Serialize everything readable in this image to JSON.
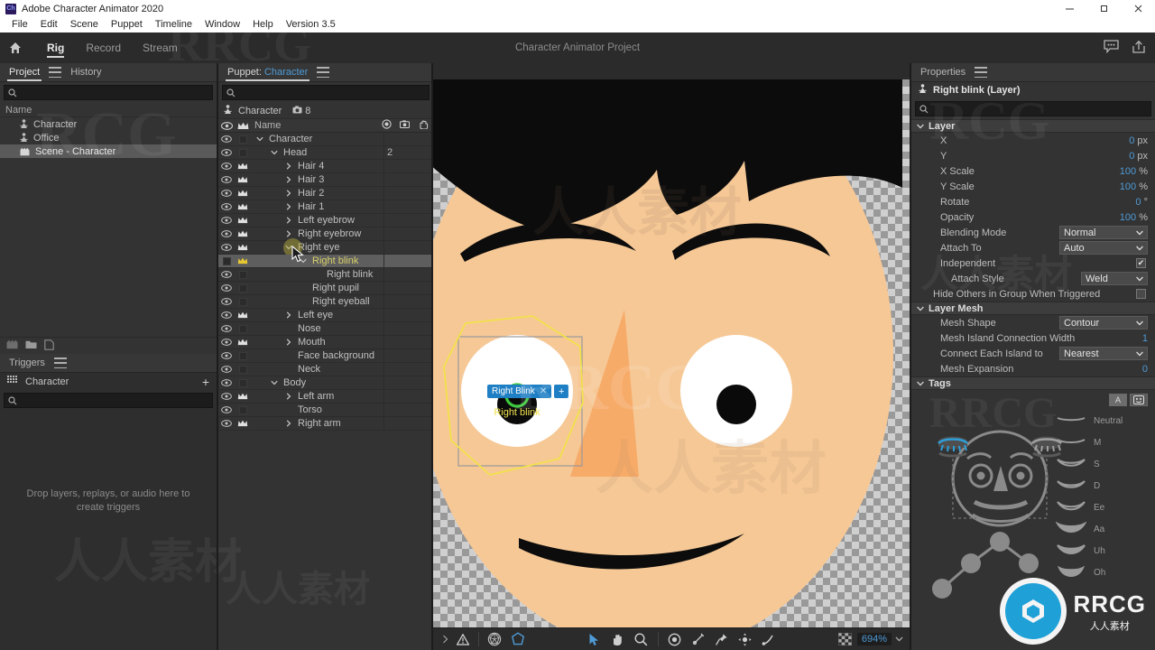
{
  "window": {
    "app_icon": "Ch",
    "title": "Adobe Character Animator 2020",
    "minimize": "minimize-icon",
    "maximize": "maximize-icon",
    "close": "close-icon"
  },
  "menubar": {
    "items": [
      "File",
      "Edit",
      "Scene",
      "Puppet",
      "Timeline",
      "Window",
      "Help",
      "Version 3.5"
    ]
  },
  "appheader": {
    "home_icon": "home-icon",
    "tabs": [
      {
        "label": "Rig",
        "active": true
      },
      {
        "label": "Record",
        "active": false
      },
      {
        "label": "Stream",
        "active": false
      }
    ],
    "project_title": "Character Animator Project",
    "comment_icon": "comment-icon",
    "share_icon": "share-icon"
  },
  "project_panel": {
    "tabs": [
      {
        "label": "Project",
        "active": true
      },
      {
        "label": "History",
        "active": false
      }
    ],
    "search_placeholder": "",
    "column_header": "Name",
    "items": [
      {
        "label": "Character",
        "icon": "puppet-icon",
        "selected": false
      },
      {
        "label": "Office",
        "icon": "puppet-icon",
        "selected": false
      },
      {
        "label": "Scene - Character",
        "icon": "scene-icon",
        "selected": true
      }
    ],
    "footer_icons": [
      "new-scene-icon",
      "new-folder-icon",
      "new-puppet-icon"
    ]
  },
  "triggers_panel": {
    "title": "Triggers",
    "menu_icon": "panel-menu-icon",
    "group_icon": "grid-icon",
    "group_label": "Character",
    "add_icon": "plus-icon",
    "search_placeholder": "",
    "empty_message_line1": "Drop layers, replays, or audio here to",
    "empty_message_line2": "create triggers"
  },
  "puppet_panel": {
    "title_prefix": "Puppet:",
    "title_name": "Character",
    "menu_icon": "panel-menu-icon",
    "search_placeholder": "",
    "puppet_name": "Character",
    "puppet_count": "8",
    "columns": {
      "name": "Name",
      "eye": "visibility-icon",
      "crown": "crown-icon",
      "origin": "origin-icon",
      "camera": "camera-icon",
      "hand": "draggable-icon"
    },
    "layers": [
      {
        "label": "Character",
        "depth": 0,
        "eye": true,
        "crown": "square",
        "twisty": "down",
        "num": "",
        "selected": false
      },
      {
        "label": "Head",
        "depth": 1,
        "eye": true,
        "crown": "square",
        "twisty": "down",
        "num": "2",
        "selected": false
      },
      {
        "label": "Hair 4",
        "depth": 2,
        "eye": true,
        "crown": "crown",
        "twisty": "right",
        "num": "",
        "selected": false
      },
      {
        "label": "Hair 3",
        "depth": 2,
        "eye": true,
        "crown": "crown",
        "twisty": "right",
        "num": "",
        "selected": false
      },
      {
        "label": "Hair 2",
        "depth": 2,
        "eye": true,
        "crown": "crown",
        "twisty": "right",
        "num": "",
        "selected": false
      },
      {
        "label": "Hair 1",
        "depth": 2,
        "eye": true,
        "crown": "crown",
        "twisty": "right",
        "num": "",
        "selected": false
      },
      {
        "label": "Left eyebrow",
        "depth": 2,
        "eye": true,
        "crown": "crown",
        "twisty": "right",
        "num": "",
        "selected": false
      },
      {
        "label": "Right eyebrow",
        "depth": 2,
        "eye": true,
        "crown": "crown",
        "twisty": "right",
        "num": "",
        "selected": false
      },
      {
        "label": "Right eye",
        "depth": 2,
        "eye": true,
        "crown": "crown",
        "twisty": "down",
        "num": "",
        "selected": false
      },
      {
        "label": "Right blink",
        "depth": 3,
        "eye": false,
        "crown": "crown-y",
        "twisty": "down",
        "num": "",
        "selected": true
      },
      {
        "label": "Right blink",
        "depth": 4,
        "eye": true,
        "crown": "square",
        "twisty": "none",
        "num": "",
        "selected": false
      },
      {
        "label": "Right pupil",
        "depth": 3,
        "eye": true,
        "crown": "square",
        "twisty": "none",
        "num": "",
        "selected": false
      },
      {
        "label": "Right eyeball",
        "depth": 3,
        "eye": true,
        "crown": "square",
        "twisty": "none",
        "num": "",
        "selected": false
      },
      {
        "label": "Left eye",
        "depth": 2,
        "eye": true,
        "crown": "crown",
        "twisty": "right",
        "num": "",
        "selected": false
      },
      {
        "label": "Nose",
        "depth": 2,
        "eye": true,
        "crown": "square",
        "twisty": "none",
        "num": "",
        "selected": false
      },
      {
        "label": "Mouth",
        "depth": 2,
        "eye": true,
        "crown": "crown",
        "twisty": "right",
        "num": "",
        "selected": false
      },
      {
        "label": "Face background",
        "depth": 2,
        "eye": true,
        "crown": "square",
        "twisty": "none",
        "num": "",
        "selected": false
      },
      {
        "label": "Neck",
        "depth": 2,
        "eye": true,
        "crown": "square",
        "twisty": "none",
        "num": "",
        "selected": false
      },
      {
        "label": "Body",
        "depth": 1,
        "eye": true,
        "crown": "square",
        "twisty": "down",
        "num": "",
        "selected": false
      },
      {
        "label": "Left arm",
        "depth": 2,
        "eye": true,
        "crown": "crown",
        "twisty": "right",
        "num": "",
        "selected": false
      },
      {
        "label": "Torso",
        "depth": 2,
        "eye": true,
        "crown": "square",
        "twisty": "none",
        "num": "",
        "selected": false
      },
      {
        "label": "Right arm",
        "depth": 2,
        "eye": true,
        "crown": "crown",
        "twisty": "right",
        "num": "",
        "selected": false
      }
    ]
  },
  "canvas": {
    "mesh_label": "Right blink",
    "tag_chip_label": "Right Blink",
    "tag_chip_remove": "close-icon",
    "tag_chip_add": "plus-icon",
    "toolbar": {
      "overflow_icon": "chevron-right-icon",
      "warning_icon": "warning-icon",
      "mesh_icon": "mesh-icon",
      "handles_icon": "handles-icon",
      "select_icon": "select-tool-icon",
      "hand_icon": "hand-tool-icon",
      "zoom_icon": "zoom-tool-icon",
      "origin_icon": "origin-tool-icon",
      "stick_icon": "stick-tool-icon",
      "pin_icon": "pin-tool-icon",
      "dragger_icon": "dragger-tool-icon",
      "stick_curve_icon": "stick-curve-tool-icon",
      "transparency_icon": "transparency-grid-icon",
      "zoom_level": "694%",
      "zoom_dropdown": "chevron-down-icon"
    },
    "colors": {
      "skin": "#f6c896",
      "hair": "#0c0c0c",
      "eye_white": "#ffffff",
      "pupil": "#0a0a0a",
      "mesh_outline": "#f2e14c",
      "tag_chip_bg": "#1f7fc4",
      "green_origin": "#3cc83c"
    }
  },
  "properties_panel": {
    "title": "Properties",
    "menu_icon": "panel-menu-icon",
    "selection_icon": "layer-icon",
    "selection_name": "Right blink (Layer)",
    "search_placeholder": "",
    "sections": [
      {
        "name": "Layer",
        "rows": [
          {
            "label": "X",
            "type": "number",
            "value": "0",
            "unit": "px"
          },
          {
            "label": "Y",
            "type": "number",
            "value": "0",
            "unit": "px"
          },
          {
            "label": "X Scale",
            "type": "number",
            "value": "100",
            "unit": "%"
          },
          {
            "label": "Y Scale",
            "type": "number",
            "value": "100",
            "unit": "%"
          },
          {
            "label": "Rotate",
            "type": "number",
            "value": "0",
            "unit": "°"
          },
          {
            "label": "Opacity",
            "type": "number",
            "value": "100",
            "unit": "%"
          },
          {
            "label": "Blending Mode",
            "type": "select",
            "value": "Normal"
          },
          {
            "label": "Attach To",
            "type": "select",
            "value": "Auto"
          },
          {
            "label": "Independent",
            "type": "checkbox",
            "value": "checked"
          },
          {
            "label": "Attach Style",
            "type": "select",
            "value": "Weld",
            "indent": 2
          },
          {
            "label": "Hide Others in Group When Triggered",
            "type": "checkbox",
            "value": "unchecked",
            "full": true
          }
        ]
      },
      {
        "name": "Layer Mesh",
        "rows": [
          {
            "label": "Mesh Shape",
            "type": "select",
            "value": "Contour"
          },
          {
            "label": "Mesh Island Connection Width",
            "type": "number",
            "value": "1",
            "unit": ""
          },
          {
            "label": "Connect Each Island to",
            "type": "select",
            "value": "Nearest"
          },
          {
            "label": "Mesh Expansion",
            "type": "number",
            "value": "0",
            "unit": ""
          }
        ]
      }
    ],
    "tags": {
      "name": "Tags",
      "toggle_text": "A",
      "toggle_face": "face-icon",
      "active_tag": "Right Blink",
      "visemes": [
        "Neutral",
        "M",
        "S",
        "D",
        "Ee",
        "Aa",
        "Uh",
        "Oh"
      ]
    }
  },
  "watermarks": {
    "brand": "RRCG",
    "brand_sub": "人人素材",
    "cn": "人人素材"
  }
}
